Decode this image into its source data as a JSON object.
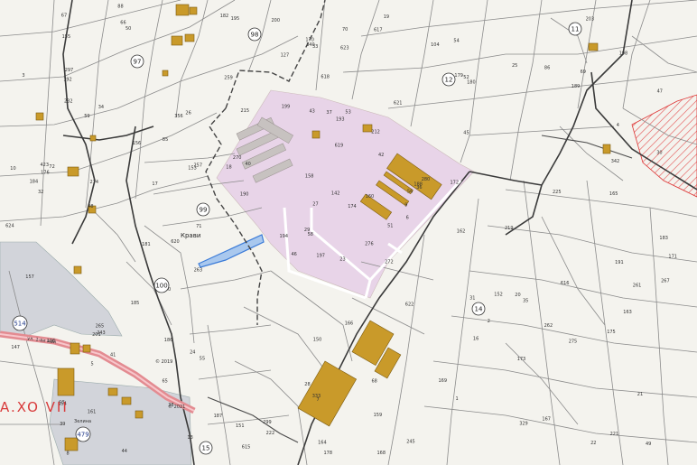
{
  "map": {
    "place_label": "Крави",
    "road_labels": [
      "ул. 1-ви май",
      "Зелина"
    ],
    "big_road_label": "A.XO VII",
    "copyright": [
      "© 2019",
      "© 2021"
    ],
    "colors": {
      "background": "#f4f3ee",
      "industrial_zone": "#e8d4e8",
      "building": "#c99a2a",
      "highlight_parcel": "#a9c8ee",
      "hatched_area": "#e24a4a",
      "grey_block": "#d2d4da",
      "main_road": "#e38b91"
    },
    "circled_numbers": [
      "98",
      "97",
      "11",
      "12",
      "99",
      "100",
      "514",
      "14",
      "15",
      "479"
    ],
    "parcel_numbers": [
      "23",
      "59",
      "58",
      "57",
      "56",
      "55",
      "54",
      "53",
      "52",
      "51",
      "50",
      "49",
      "48",
      "47",
      "46",
      "45",
      "44",
      "43",
      "42",
      "41",
      "40",
      "39",
      "38",
      "37",
      "36",
      "35",
      "34",
      "33",
      "32",
      "31",
      "30",
      "29",
      "28",
      "27",
      "26",
      "25",
      "24",
      "22",
      "21",
      "20",
      "19",
      "18",
      "17",
      "16",
      "13",
      "10",
      "9",
      "8",
      "7",
      "6",
      "5",
      "4",
      "3",
      "2",
      "1",
      "65",
      "66",
      "67",
      "68",
      "69",
      "70",
      "71",
      "72",
      "85",
      "86",
      "88",
      "104",
      "127",
      "142",
      "147",
      "150",
      "151",
      "152",
      "153",
      "154",
      "155",
      "156",
      "157",
      "158",
      "159",
      "160",
      "161",
      "162",
      "163",
      "164",
      "165",
      "166",
      "167",
      "168",
      "169",
      "170",
      "171",
      "172",
      "173",
      "174",
      "175",
      "176",
      "178",
      "179",
      "180",
      "181",
      "182",
      "183",
      "184",
      "185",
      "186",
      "187",
      "188",
      "189",
      "190",
      "191",
      "192",
      "193",
      "194",
      "195",
      "196",
      "197",
      "198",
      "199",
      "200",
      "201",
      "203",
      "212",
      "215",
      "219",
      "220",
      "221",
      "222",
      "225",
      "232",
      "243",
      "245",
      "257",
      "259",
      "261",
      "262",
      "263",
      "265",
      "267",
      "270",
      "272",
      "274",
      "275",
      "276",
      "280",
      "297",
      "299",
      "329",
      "333",
      "340",
      "342",
      "356",
      "423",
      "615",
      "616",
      "617",
      "618",
      "619",
      "620",
      "621",
      "622",
      "623",
      "624"
    ]
  }
}
